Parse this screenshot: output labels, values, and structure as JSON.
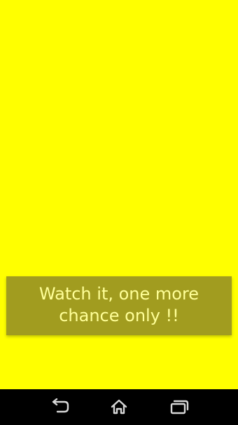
{
  "screen": {
    "background_color": "#ffff00"
  },
  "toast": {
    "message": "Watch it, one more chance only !!",
    "background_color": "#a19c1f",
    "text_color": "#ffff98"
  },
  "navigation_bar": {
    "buttons": [
      {
        "icon": "back-icon"
      },
      {
        "icon": "home-icon"
      },
      {
        "icon": "recent-apps-icon"
      }
    ]
  }
}
